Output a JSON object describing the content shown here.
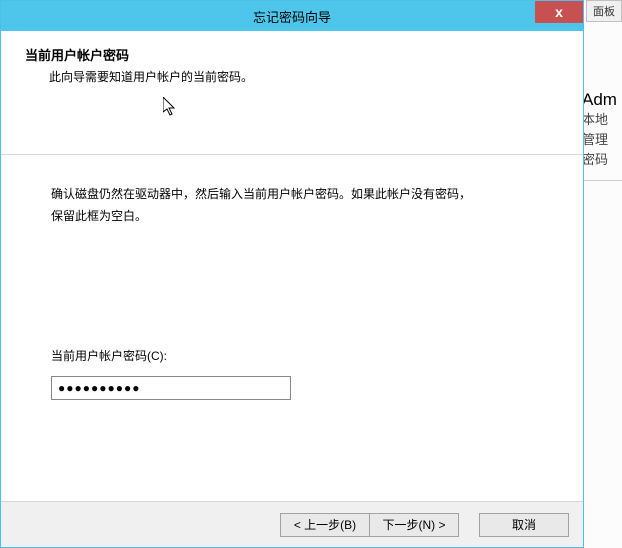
{
  "window": {
    "title": "忘记密码向导",
    "close_label": "x"
  },
  "header": {
    "title": "当前用户帐户密码",
    "subtext": "此向导需要知道用户帐户的当前密码。"
  },
  "body": {
    "instruction_line1": "确认磁盘仍然在驱动器中，然后输入当前用户帐户密码。如果此帐户没有密码，",
    "instruction_line2": "保留此框为空白。",
    "field_label": "当前用户帐户密码(C):",
    "password_value": "●●●●●●●●●●"
  },
  "footer": {
    "back_label": "< 上一步(B)",
    "next_label": "下一步(N) >",
    "cancel_label": "取消"
  },
  "background": {
    "tab": "面板",
    "line1": "Adm",
    "line2": "本地",
    "line3": "管理",
    "line4": "密码"
  }
}
